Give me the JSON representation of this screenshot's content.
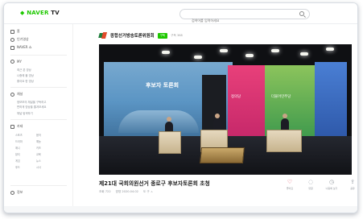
{
  "header": {
    "logo_prefix": "◆ NAVER",
    "logo_suffix": " TV",
    "search_placeholder": "검색어를 입력하세요"
  },
  "sidebar": {
    "items": [
      {
        "label": "홈"
      },
      {
        "label": "인기영상"
      },
      {
        "label": "NAVER 쇼"
      },
      {
        "label": "MY"
      },
      {
        "label": "채널"
      },
      {
        "label": "카테"
      }
    ],
    "my_subs": [
      "최근 본 영상",
      "나중에 볼 영상",
      "좋아요 한 영상"
    ],
    "channel_subs": [
      "정보보의 채널을 구독하고",
      "편하게 영상을 즐겨보세요",
      "채널 탐색하기"
    ],
    "category_grid": [
      "스포츠",
      "음악",
      "드라마",
      "예능",
      "애니",
      "키즈",
      "뷰티",
      "교육",
      "게임",
      "뉴스",
      "푸드",
      "시사"
    ],
    "bottom_item": {
      "label": "정보"
    }
  },
  "channel": {
    "name": "종합선거방송토론위원회",
    "live_label": "구독",
    "count": "구독 368"
  },
  "video": {
    "screen_text_left": "후보자 토론회",
    "screen_text_red": "정의당",
    "screen_text_green": "더불어민주당",
    "title": "제21대 국회의원선거 종로구 후보자토론회 초청",
    "meta": [
      "조회 722",
      "방영 2020.04.02",
      "도 구 ㅅ"
    ]
  },
  "actions": [
    {
      "icon": "heart-icon",
      "glyph": "♡",
      "label": "좋아요"
    },
    {
      "icon": "comment-icon",
      "glyph": "◌",
      "label": "댓글"
    },
    {
      "icon": "later-icon",
      "glyph": "◷",
      "label": "나중에 보기"
    },
    {
      "icon": "share-icon",
      "glyph": "⇪",
      "label": "공유"
    }
  ],
  "colors": {
    "brand": "#1ec800",
    "heart": "#e04a5f"
  }
}
